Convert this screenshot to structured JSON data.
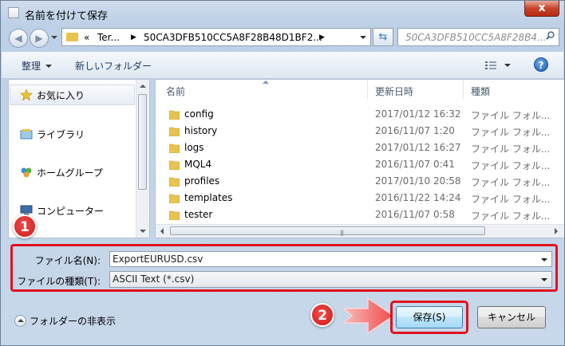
{
  "window": {
    "title": "名前を付けて保存",
    "close_label": "x"
  },
  "address": {
    "crumbs": [
      "«",
      "Ter...",
      "50CA3DFB510CC5A8F28B48D1BF2..."
    ],
    "search_placeholder": "50CA3DFB510CC5A8F28B4..."
  },
  "toolbar": {
    "organize": "整理",
    "new_folder": "新しいフォルダー",
    "help": "?"
  },
  "nav": {
    "items": [
      "お気に入り",
      "ライブラリ",
      "ホームグループ",
      "コンピューター"
    ]
  },
  "list": {
    "columns": [
      "名前",
      "更新日時",
      "種類"
    ],
    "rows": [
      {
        "name": "config",
        "date": "2017/01/12 16:32",
        "type": "ファイル フォル..."
      },
      {
        "name": "history",
        "date": "2016/11/07 1:20",
        "type": "ファイル フォル..."
      },
      {
        "name": "logs",
        "date": "2017/01/12 16:27",
        "type": "ファイル フォル..."
      },
      {
        "name": "MQL4",
        "date": "2016/11/07 0:41",
        "type": "ファイル フォル..."
      },
      {
        "name": "profiles",
        "date": "2017/01/10 20:58",
        "type": "ファイル フォル..."
      },
      {
        "name": "templates",
        "date": "2016/11/22 14:24",
        "type": "ファイル フォル..."
      },
      {
        "name": "tester",
        "date": "2016/11/07 0:58",
        "type": "ファイル フォル..."
      }
    ],
    "scroll_grip": "|||"
  },
  "form": {
    "filename_label": "ファイル名(N):",
    "filename_value": "ExportEURUSD.csv",
    "filetype_label": "ファイルの種類(T):",
    "filetype_value": "ASCII Text (*.csv)"
  },
  "footer": {
    "hide_folders": "フォルダーの非表示",
    "save_label": "保存(S)",
    "cancel_label": "キャンセル"
  },
  "annotations": {
    "badge1": "1",
    "badge2": "2"
  },
  "colors": {
    "highlight": "#e0121e",
    "folder": "#e9c350",
    "arrow": "#f36a6a"
  }
}
